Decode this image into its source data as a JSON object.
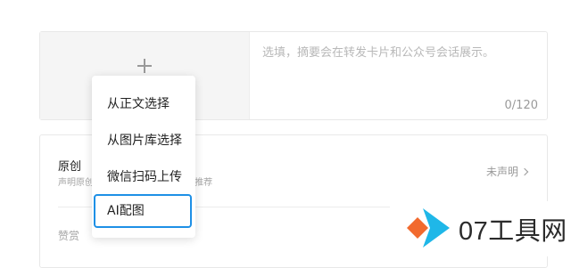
{
  "cover": {
    "summary_placeholder": "选填，摘要会在转发卡片和公众号会话展示。",
    "summary_counter": "0/120"
  },
  "settings": {
    "original": {
      "title": "原创",
      "description": "声明原创                        作权保护，并有可能得到推荐",
      "status": "未声明"
    },
    "reward": {
      "label": "赞赏"
    }
  },
  "cover_menu": {
    "items": [
      {
        "label": "从正文选择"
      },
      {
        "label": "从图片库选择"
      },
      {
        "label": "微信扫码上传"
      },
      {
        "label": "AI配图"
      }
    ],
    "selected_index": 3
  },
  "watermark": {
    "text": "07工具网",
    "colors": {
      "cyan": "#1fb7e8",
      "orange": "#f26a2e"
    }
  }
}
